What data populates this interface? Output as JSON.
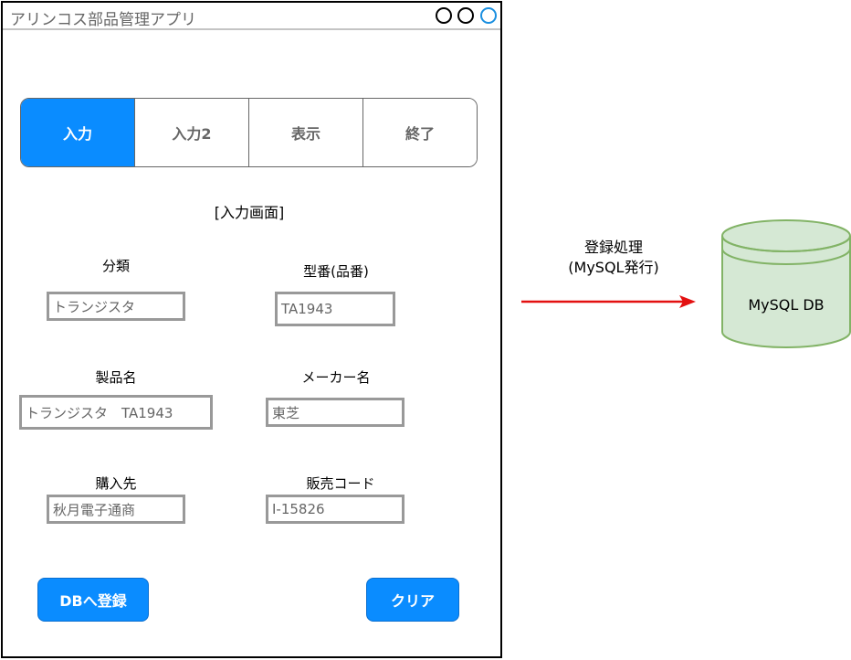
{
  "window": {
    "title": "アリンコス部品管理アプリ"
  },
  "tabs": [
    {
      "label": "入力",
      "active": true
    },
    {
      "label": "入力2",
      "active": false
    },
    {
      "label": "表示",
      "active": false
    },
    {
      "label": "終了",
      "active": false
    }
  ],
  "screen_label": "[入力画面]",
  "form": {
    "category": {
      "label": "分類",
      "value": "トランジスタ"
    },
    "model": {
      "label": "型番(品番)",
      "value": "TA1943"
    },
    "product": {
      "label": "製品名",
      "value": "トランジスタ　TA1943"
    },
    "maker": {
      "label": "メーカー名",
      "value": "東芝"
    },
    "supplier": {
      "label": "購入先",
      "value": "秋月電子通商"
    },
    "sales_code": {
      "label": "販売コード",
      "value": "I-15826"
    }
  },
  "buttons": {
    "register": "DBへ登録",
    "clear": "クリア"
  },
  "flow": {
    "line1": "登録処理",
    "line2": "(MySQL発行)",
    "db_label": "MySQL DB",
    "arrow_color": "#e31010",
    "db_fill": "#d5e8d4",
    "db_stroke": "#82b366"
  },
  "colors": {
    "accent": "#0a8cff"
  }
}
